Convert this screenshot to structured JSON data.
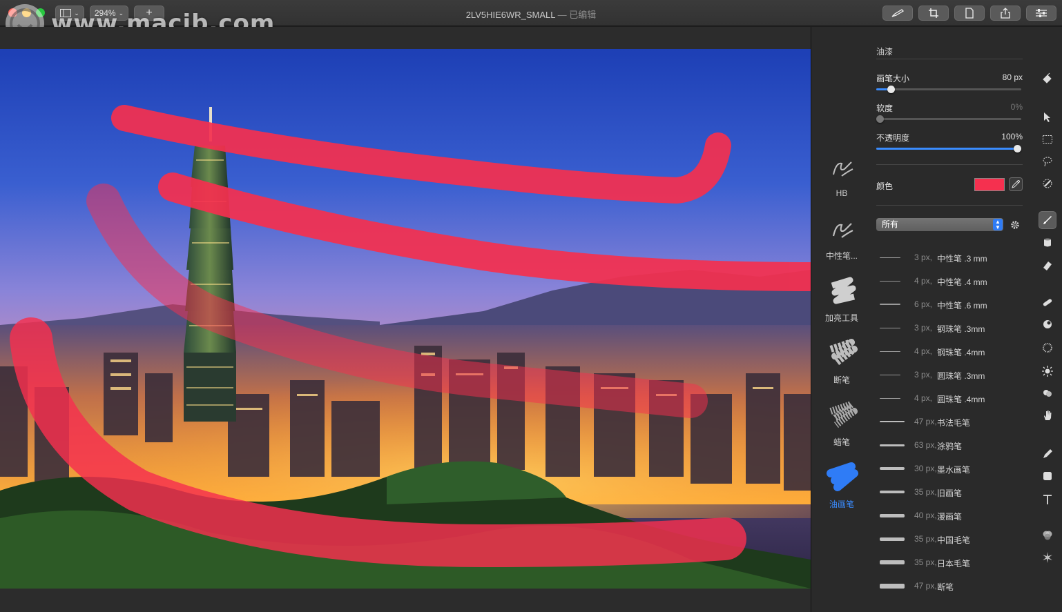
{
  "window": {
    "title": "2LV5HIE6WR_SMALL",
    "edited_suffix": "— 已编辑",
    "zoom": "294%",
    "watermark": "www.macjb.com"
  },
  "toolbar": {
    "left_buttons": [
      "sidebar-toggle",
      "zoom",
      "add"
    ],
    "right_icons": [
      "brush-settings-icon",
      "crop-icon",
      "document-icon",
      "share-icon",
      "adjust-icon"
    ]
  },
  "brush_categories": [
    {
      "label": "HB",
      "active": false
    },
    {
      "label": "中性笔...",
      "active": false
    },
    {
      "label": "加亮工具",
      "active": false
    },
    {
      "label": "断笔",
      "active": false
    },
    {
      "label": "蜡笔",
      "active": false
    },
    {
      "label": "油画笔",
      "active": true
    }
  ],
  "settings": {
    "section_title": "油漆",
    "brush_size": {
      "label": "画笔大小",
      "value": "80 px",
      "fraction": 0.1
    },
    "softness": {
      "label": "软度",
      "value": "0%",
      "fraction": 0.0
    },
    "opacity": {
      "label": "不透明度",
      "value": "100%",
      "fraction": 1.0
    },
    "color": {
      "label": "颜色",
      "hex": "#f5304f"
    },
    "filter": {
      "selected": "所有"
    }
  },
  "presets": [
    {
      "size": "3 px,",
      "name": "中性笔 .3 mm"
    },
    {
      "size": "4 px,",
      "name": "中性笔 .4 mm"
    },
    {
      "size": "6 px,",
      "name": "中性笔 .6 mm"
    },
    {
      "size": "3 px,",
      "name": "钢珠笔 .3mm"
    },
    {
      "size": "4 px,",
      "name": "钢珠笔 .4mm"
    },
    {
      "size": "3 px,",
      "name": "圆珠笔 .3mm"
    },
    {
      "size": "4 px,",
      "name": "圆珠笔 .4mm"
    },
    {
      "size": "47 px,",
      "name": "书法毛笔"
    },
    {
      "size": "63 px,",
      "name": "涂鸦笔"
    },
    {
      "size": "30 px,",
      "name": "墨水画笔"
    },
    {
      "size": "35 px,",
      "name": "旧画笔"
    },
    {
      "size": "40 px,",
      "name": "漫画笔"
    },
    {
      "size": "35 px,",
      "name": "中国毛笔"
    },
    {
      "size": "35 px,",
      "name": "日本毛笔"
    },
    {
      "size": "47 px,",
      "name": "断笔"
    }
  ],
  "tools": [
    "paint-bucket-icon",
    "arrow-select-icon",
    "rect-select-icon",
    "lasso-icon",
    "magic-select-icon",
    "paintbrush-icon",
    "paint-pot-icon",
    "eraser-icon",
    "bandage-icon",
    "clone-icon",
    "blur-icon",
    "sharpen-icon",
    "smudge-icon",
    "hand-icon",
    "pen-icon",
    "shape-icon",
    "text-icon",
    "color-adjust-icon",
    "effects-icon"
  ],
  "colors": {
    "accent": "#3a8cff",
    "paint_red": "#f5304f",
    "panel_bg": "#2a2a2a"
  }
}
